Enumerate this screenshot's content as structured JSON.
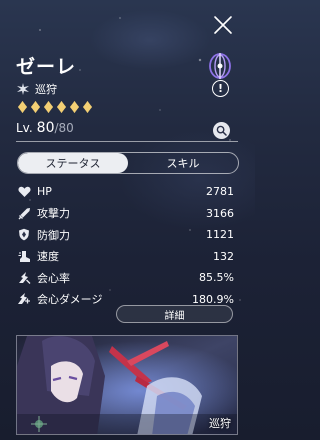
{
  "character": {
    "name": "ゼーレ",
    "path": "巡狩",
    "rank_stars": 6,
    "level_prefix": "Lv.",
    "level": "80",
    "level_max": "/80"
  },
  "tabs": [
    {
      "label": "ステータス",
      "active": true
    },
    {
      "label": "スキル",
      "active": false
    }
  ],
  "stats": [
    {
      "icon": "heart-icon",
      "name": "HP",
      "value": "2781"
    },
    {
      "icon": "sword-icon",
      "name": "攻撃力",
      "value": "3166"
    },
    {
      "icon": "shield-icon",
      "name": "防御力",
      "value": "1121"
    },
    {
      "icon": "boot-icon",
      "name": "速度",
      "value": "132"
    },
    {
      "icon": "crit-rate-icon",
      "name": "会心率",
      "value": "85.5%"
    },
    {
      "icon": "crit-damage-icon",
      "name": "会心ダメージ",
      "value": "180.9%"
    }
  ],
  "detail_button": "詳細",
  "lightcone": {
    "path_label": "巡狩"
  },
  "colors": {
    "element_quantum": "#7a5cd6",
    "rank_gold": "#f3cf74"
  }
}
